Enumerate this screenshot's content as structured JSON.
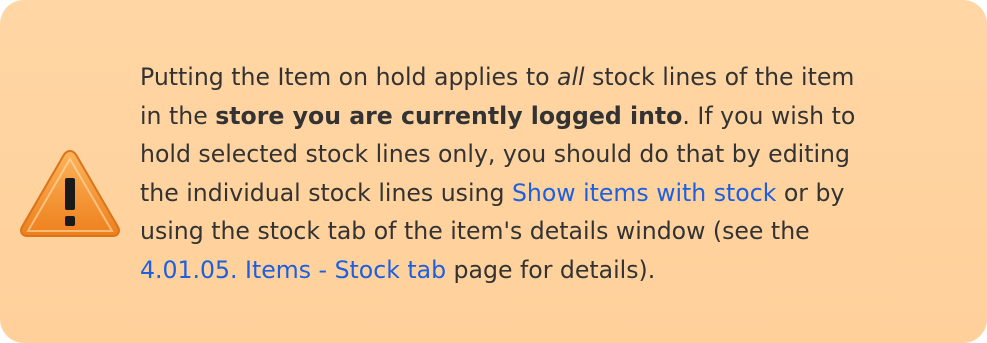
{
  "note": {
    "icon": "warning-icon",
    "colors": {
      "background": "#ffd39f",
      "link": "#1c5fe0",
      "text": "#333333",
      "icon_fill": "#f59a35",
      "icon_mark": "#1a1a1a"
    },
    "line1": {
      "before": "Putting the Item on hold applies to ",
      "emphasis": "all",
      "after": " stock lines of the item"
    },
    "line2": {
      "before": "in the ",
      "strong": "store you are currently logged into",
      "after": ". If you wish to"
    },
    "line3": {
      "text": "hold selected stock lines only, you should do that by editing"
    },
    "line4": {
      "before": "the individual stock lines using ",
      "link": "Show items with stock",
      "after": " or by"
    },
    "line5": {
      "text": "using the stock tab of the item's details window (see the"
    },
    "line6": {
      "link": "4.01.05. Items - Stock tab",
      "after": " page for details)."
    }
  }
}
